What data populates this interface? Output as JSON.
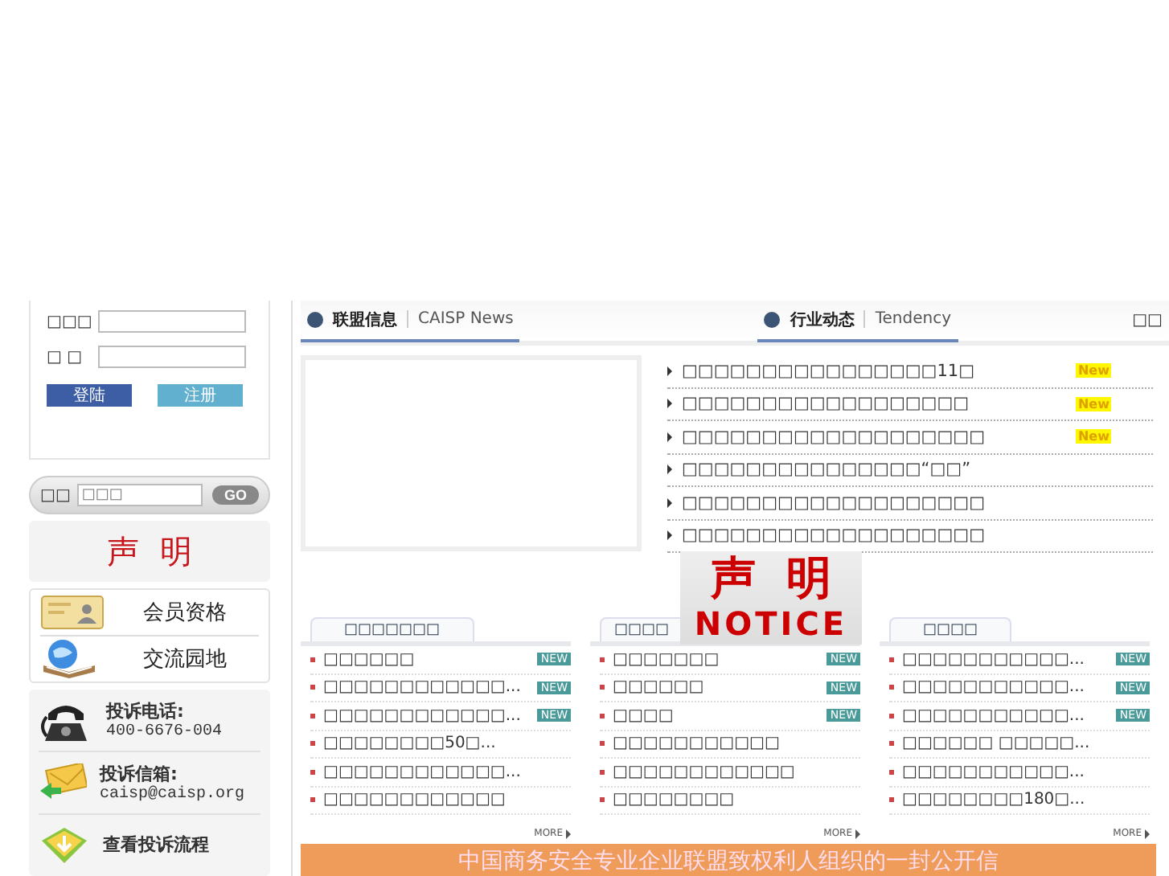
{
  "login": {
    "username_label": "□□□",
    "password_label": "□ □",
    "buttons": [
      {
        "label": "登陆",
        "kind": "primary"
      },
      {
        "label": "注册",
        "kind": "secondary"
      }
    ]
  },
  "search": {
    "label": "□□",
    "placeholder": "□□□",
    "button": "GO"
  },
  "statement": {
    "title": "声  明"
  },
  "member_links": [
    {
      "label": "会员资格"
    },
    {
      "label": "交流园地"
    }
  ],
  "contacts": [
    {
      "title": "投诉电话:",
      "value": "400-6676-004"
    },
    {
      "title": "投诉信箱:",
      "value": "caisp@caisp.org"
    },
    {
      "title": "查看投诉流程"
    }
  ],
  "header_tabs": [
    {
      "title": "联盟信息",
      "subtitle": "CAISP News",
      "selected": true
    },
    {
      "title": "行业动态",
      "subtitle": "Tendency",
      "selected": true
    }
  ],
  "header_more": "□□",
  "news": [
    {
      "text": "□□□□□□□□□□□□□□□□11□",
      "badge": "New"
    },
    {
      "text": "□□□□□□□□□□□□□□□□□□",
      "badge": "New"
    },
    {
      "text": "□□□□□□□□□□□□□□□□□□□",
      "badge": "New"
    },
    {
      "text": "□□□□□□□□□□□□□□□“□□”"
    },
    {
      "text": "□□□□□□□□□□□□□□□□□□□"
    },
    {
      "text": "□□□□□□□□□□□□□□□□□□□"
    }
  ],
  "notice": {
    "title": "声  明",
    "subtitle": "NOTICE"
  },
  "columns": [
    {
      "title": "□□□□□□□",
      "more": "MORE",
      "items": [
        {
          "text": "□□□□□□",
          "badge": "NEW"
        },
        {
          "text": "□□□□□□□□□□□□...",
          "badge": "NEW"
        },
        {
          "text": "□□□□□□□□□□□□...",
          "badge": "NEW"
        },
        {
          "text": "□□□□□□□□50□..."
        },
        {
          "text": "□□□□□□□□□□□□..."
        },
        {
          "text": "□□□□□□□□□□□□"
        }
      ]
    },
    {
      "title": "□□□□",
      "more": "MORE",
      "items": [
        {
          "text": "□□□□□□□",
          "badge": "NEW"
        },
        {
          "text": "□□□□□□",
          "badge": "NEW"
        },
        {
          "text": "□□□□",
          "badge": "NEW"
        },
        {
          "text": "□□□□□□□□□□□"
        },
        {
          "text": "□□□□□□□□□□□□"
        },
        {
          "text": "□□□□□□□□"
        }
      ]
    },
    {
      "title": "□□□□",
      "more": "MORE",
      "items": [
        {
          "text": "□□□□□□□□□□□...",
          "badge": "NEW"
        },
        {
          "text": "□□□□□□□□□□□...",
          "badge": "NEW"
        },
        {
          "text": "□□□□□□□□□□□...",
          "badge": "NEW"
        },
        {
          "text": "□□□□□□ □□□□□..."
        },
        {
          "text": "□□□□□□□□□□□..."
        },
        {
          "text": "□□□□□□□□180□..."
        }
      ]
    }
  ],
  "banner": "中国商务安全专业企业联盟致权利人组织的一封公开信"
}
